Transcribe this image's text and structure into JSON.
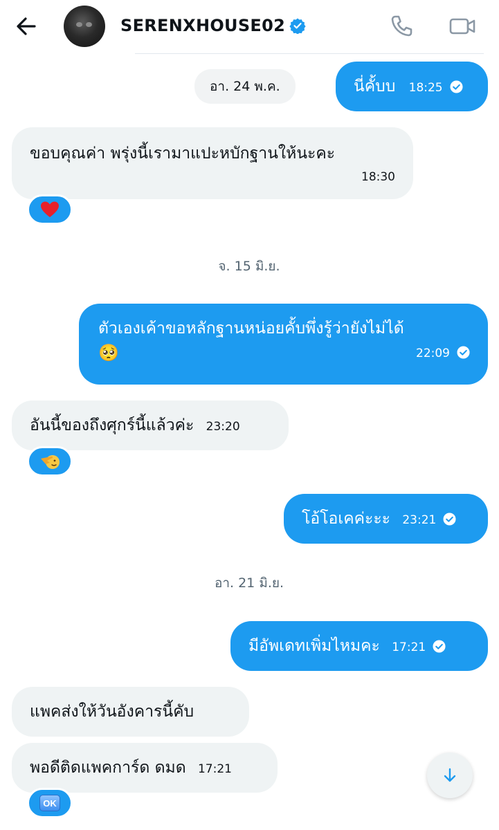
{
  "header": {
    "contact_name": "SERENXHOUSE02"
  },
  "messages": {
    "date1": "อา. 24 พ.ค.",
    "m1_text": "นี่คั้บบ",
    "m1_time": "18:25",
    "m2_text": "ขอบคุณค่า พรุ่งนี้เรามาแปะหบักฐานให้นะคะ",
    "m2_time": "18:30",
    "date2": "จ. 15 มิ.ย.",
    "m3_text": "ตัวเองเค้าขอหลักฐานหน่อยคั้บพึ่งรู้ว่ายังไม่ได้",
    "m3_emoji": "🥺",
    "m3_time": "22:09",
    "m4_text": "อันนี้ของถึงศุกร์นี้แล้วค่ะ",
    "m4_time": "23:20",
    "m5_text": "โอ้โอเคค่ะะะ",
    "m5_time": "23:21",
    "date3": "อา. 21 มิ.ย.",
    "m6_text": "มีอัพเดทเพิ่มไหมคะ",
    "m6_time": "17:21",
    "m7_text": "แพคส่งให้วันอังคารนี้คับ",
    "m8_text": "พอดีติดแพคการ์ด ดมด",
    "m8_time": "17:21",
    "reaction_ok": "OK"
  },
  "colors": {
    "accent": "#1d9bf0",
    "incoming_bubble": "#eff3f4",
    "date_text": "#536471"
  }
}
